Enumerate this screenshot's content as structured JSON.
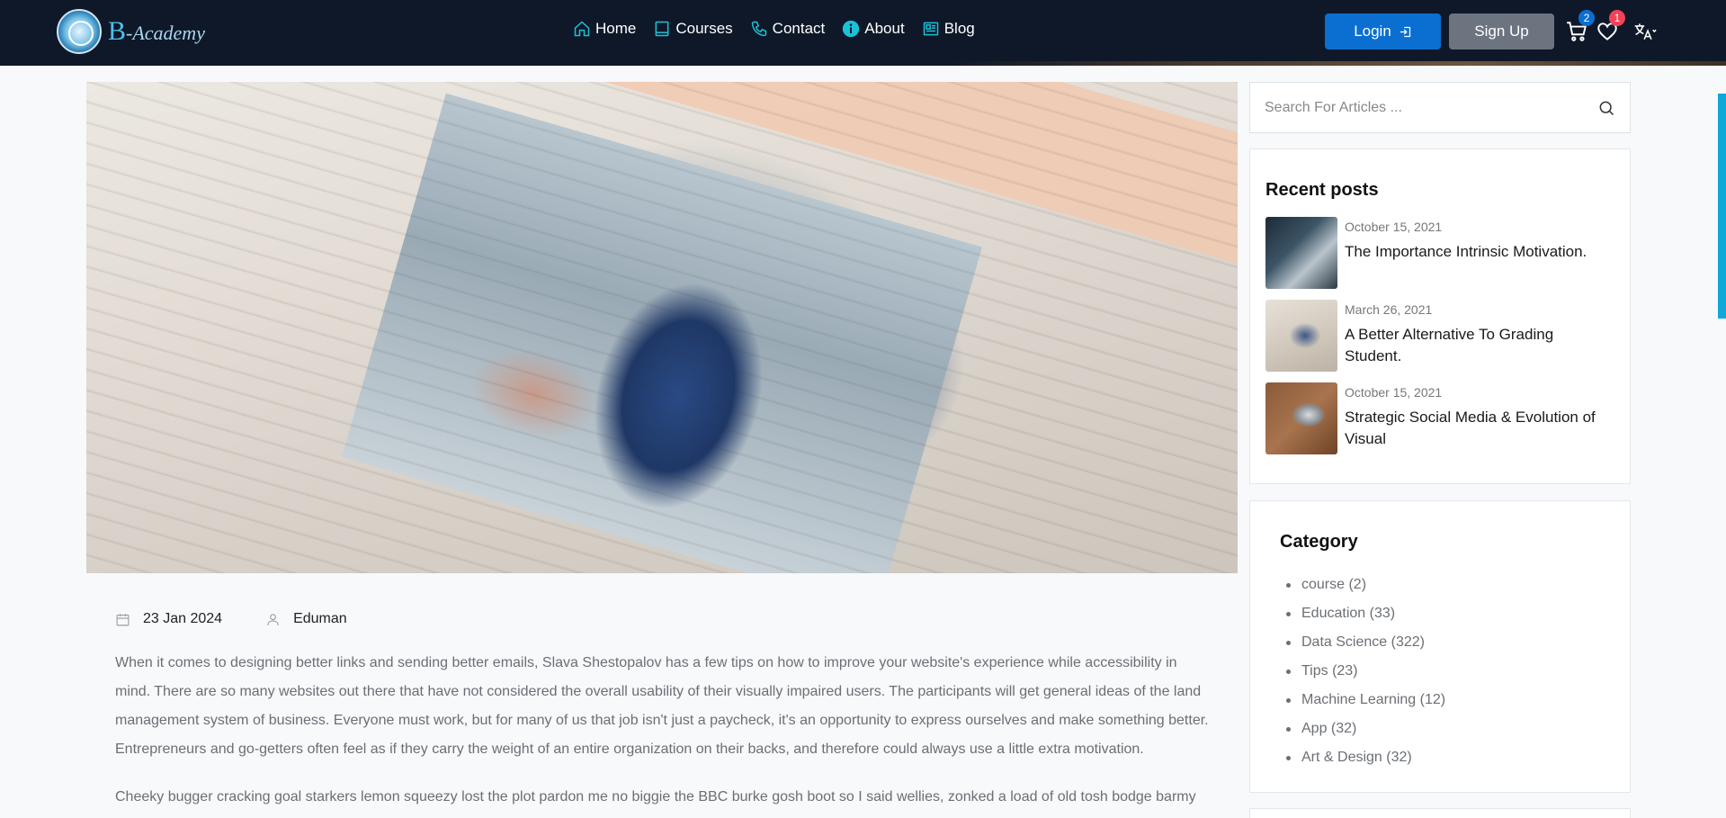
{
  "brand": {
    "initial": "B",
    "rest": "-Academy"
  },
  "nav": [
    {
      "label": "Home",
      "icon": "home-icon"
    },
    {
      "label": "Courses",
      "icon": "book-icon"
    },
    {
      "label": "Contact",
      "icon": "phone-icon"
    },
    {
      "label": "About",
      "icon": "info-icon"
    },
    {
      "label": "Blog",
      "icon": "newspaper-icon"
    }
  ],
  "auth": {
    "login_label": "Login",
    "signup_label": "Sign Up"
  },
  "cart": {
    "count": "2"
  },
  "wishlist": {
    "count": "1"
  },
  "post": {
    "date": "23 Jan 2024",
    "author": "Eduman",
    "paragraph1": "When it comes to designing better links and sending better emails, Slava Shestopalov has a few tips on how to improve your website's experience while accessibility in mind. There are so many websites out there that have not considered the overall usability of their visually impaired users. The participants will get general ideas of the land management system of business. Everyone must work, but for many of us that job isn't just a paycheck, it's an opportunity to express ourselves and make something better. Entrepreneurs and go-getters often feel as if they carry the weight of an entire organization on their backs, and therefore could always use a little extra motivation.",
    "paragraph2": "Cheeky bugger cracking goal starkers lemon squeezy lost the plot pardon me no biggie the BBC burke gosh boot so I said wellies, zonked a load of old tosh bodge barmy"
  },
  "search": {
    "placeholder": "Search For Articles ..."
  },
  "recent": {
    "heading": "Recent posts",
    "items": [
      {
        "date": "October 15, 2021",
        "title": "The Importance Intrinsic Motivation."
      },
      {
        "date": "March 26, 2021",
        "title": "A Better Alternative To Grading Student."
      },
      {
        "date": "October 15, 2021",
        "title": "Strategic Social Media & Evolution of Visual"
      }
    ]
  },
  "category": {
    "heading": "Category",
    "items": [
      "course (2)",
      "Education (33)",
      "Data Science (322)",
      "Tips (23)",
      "Machine Learning (12)",
      "App (32)",
      "Art & Design (32)"
    ]
  },
  "colors": {
    "accent": "#0a6fd1",
    "header_bg": "#0f1829",
    "badge_red": "#f0435a",
    "secondary_btn": "#6c7480"
  }
}
